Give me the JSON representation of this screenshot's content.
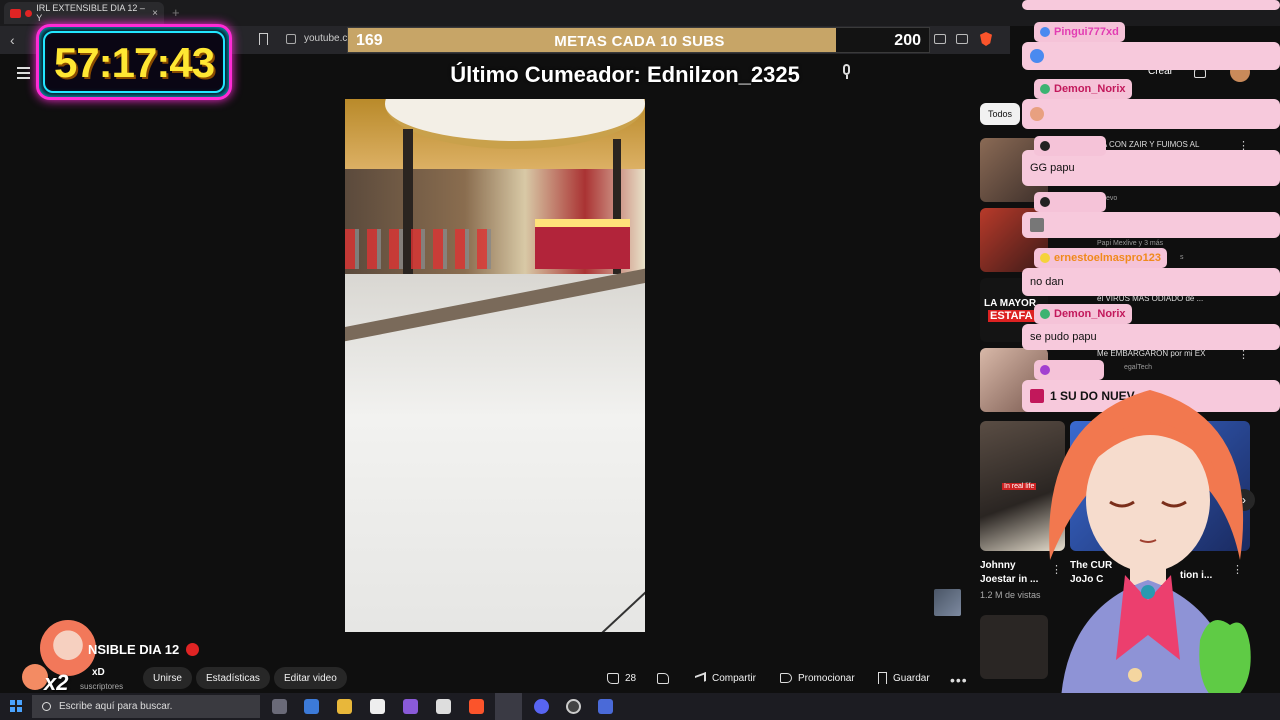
{
  "browser": {
    "tab_title": "IRL EXTENSIBLE DIA 12 – Y",
    "url": "youtube.c"
  },
  "overlay": {
    "timer": "57:17:43",
    "subs_bar": {
      "start": "169",
      "label": "METAS CADA 10 SUBS",
      "end": "200",
      "progress_fraction": 0.84
    },
    "last_cumeador": "Último Cumeador: Ednilzon_2325",
    "multiplier": "x2"
  },
  "video": {
    "title": "NSIBLE DIA 12",
    "channel_name": "xD",
    "subscribers": "suscriptores",
    "buttons": {
      "join": "Unirse",
      "stats": "Estadísticas",
      "edit": "Editar video"
    },
    "actions": {
      "likes": "28",
      "share": "Compartir",
      "promote": "Promocionar",
      "save": "Guardar"
    }
  },
  "header": {
    "create": "Crear"
  },
  "sidebar": {
    "filter": "Todos",
    "items": [
      {
        "title": "ZA CON ZAIR Y FUIMOS AL",
        "meta": "8.9 K vistas · hace 1 día",
        "extra": "evo"
      },
      {
        "title": "",
        "meta": "Papi Mexlive y 3 más",
        "extra": "s"
      },
      {
        "title": "el VIRUS MÁS ODIADO de ...",
        "meta": "",
        "thumb_text_1": "LA MAYOR",
        "thumb_text_2": "ESTAFA"
      },
      {
        "title": "Me EMBARGARON por mi EX",
        "meta": "egalTech"
      }
    ],
    "cards": [
      {
        "title": "Johnny Joestar in ...",
        "views": "1.2 M de vistas",
        "badge": "In real life"
      },
      {
        "title": "The CUR JoJo C",
        "suffix": "tion i..."
      }
    ]
  },
  "chat": [
    {
      "user": "Pingui777xd",
      "message": ""
    },
    {
      "user": "Demon_Norix",
      "message": ""
    },
    {
      "user": "",
      "message": "GG papu"
    },
    {
      "user": "",
      "message": ""
    },
    {
      "user": "ernestoelmaspro123",
      "message": "no dan"
    },
    {
      "user": "Demon_Norix",
      "message": "se pudo papu"
    },
    {
      "user": "",
      "message": "1 SU DO NUEV"
    }
  ],
  "taskbar": {
    "search_placeholder": "Escribe aquí para buscar."
  },
  "colors": {
    "accent": "#e02424",
    "chat_bg": "#f7c9dc",
    "timer_digits": "#ffe733",
    "subs_fill": "#c7a567"
  },
  "icons": [
    "youtube-icon",
    "back-arrow-icon",
    "bookmark-icon",
    "site-info-icon",
    "brave-icon",
    "menu-icon",
    "mic-icon",
    "like-icon",
    "dislike-icon",
    "share-icon",
    "promote-icon",
    "save-icon",
    "more-icon",
    "bell-icon",
    "windows-icon",
    "search-icon"
  ]
}
